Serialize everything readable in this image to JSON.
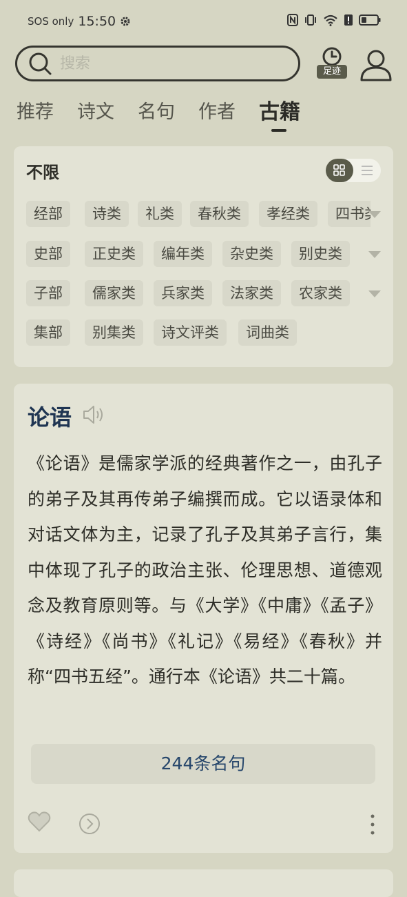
{
  "status_bar": {
    "carrier": "SOS only",
    "time": "15:50",
    "icons": [
      "gear-icon",
      "nfc-icon",
      "vibrate-icon",
      "wifi-icon",
      "alert-icon",
      "battery-icon"
    ]
  },
  "header": {
    "search_placeholder": "搜索",
    "footprint_label": "足迹"
  },
  "tabs": [
    {
      "label": "推荐"
    },
    {
      "label": "诗文"
    },
    {
      "label": "名句"
    },
    {
      "label": "作者"
    },
    {
      "label": "古籍",
      "active": true
    }
  ],
  "filter": {
    "title": "不限",
    "rows": [
      [
        "经部",
        "诗类",
        "礼类",
        "春秋类",
        "孝经类",
        "四书类"
      ],
      [
        "史部",
        "正史类",
        "编年类",
        "杂史类",
        "别史类"
      ],
      [
        "子部",
        "儒家类",
        "兵家类",
        "法家类",
        "农家类"
      ],
      [
        "集部",
        "别集类",
        "诗文评类",
        "词曲类"
      ]
    ]
  },
  "book": {
    "title": "论语",
    "description": "《论语》是儒家学派的经典著作之一，由孔子的弟子及其再传弟子编撰而成。它以语录体和对话文体为主，记录了孔子及其弟子言行，集中体现了孔子的政治主张、伦理思想、道德观念及教育原则等。与《大学》《中庸》《孟子》《诗经》《尚书》《礼记》《易经》《春秋》并称“四书五经”。通行本《论语》共二十篇。",
    "quotes_label": "244条名句"
  },
  "colors": {
    "background": "#d6d6c3",
    "card": "#e3e3d5",
    "chip": "#d8d8ca",
    "accent_dark": "#5a5b4a",
    "title_blue": "#1f3552",
    "link_blue": "#26466b"
  }
}
